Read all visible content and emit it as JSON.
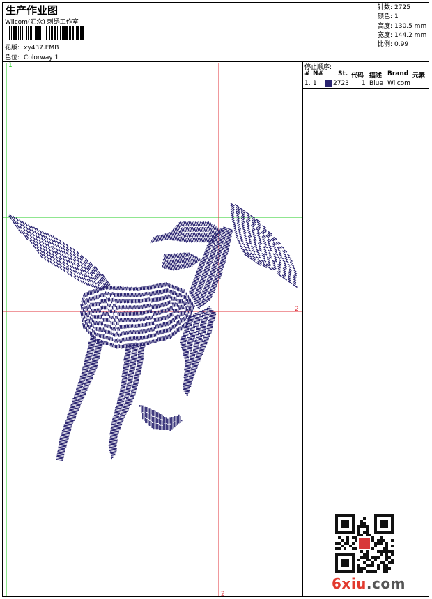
{
  "header": {
    "title": "生产作业图",
    "company": "Wilcom(汇众) 刺绣工作室",
    "design_label": "花版:",
    "design_value": "xy437.EMB",
    "colorway_label": "色位:",
    "colorway_value": "Colorway 1"
  },
  "stats": [
    {
      "label": "针数:",
      "value": "2725"
    },
    {
      "label": "颜色:",
      "value": "1"
    },
    {
      "label": "高度:",
      "value": "130.5 mm"
    },
    {
      "label": "宽度:",
      "value": "144.2 mm"
    },
    {
      "label": "比例:",
      "value": "0.99"
    }
  ],
  "stop_sequence": {
    "title": "停止顺序:",
    "headers": [
      "#",
      "N#",
      "St.",
      "代码",
      "描述",
      "Brand",
      "元素"
    ],
    "rows": [
      {
        "index": "1.",
        "needle": "1",
        "stitches": "2723",
        "code": "1",
        "description": "Blue",
        "brand": "Wilcom",
        "color": "#2a2470"
      }
    ]
  },
  "guides": {
    "top_left_label": "1",
    "right_label": "2",
    "bottom_label": "2",
    "vertical_color": "#e0303a",
    "horizontal_color": "#e0303a",
    "green_color": "#22cc22"
  },
  "design": {
    "subject": "horse-embroidery",
    "thread_color": "#2a2470"
  },
  "watermark": {
    "logo_red": "6xiu",
    "logo_dark": ".com"
  }
}
